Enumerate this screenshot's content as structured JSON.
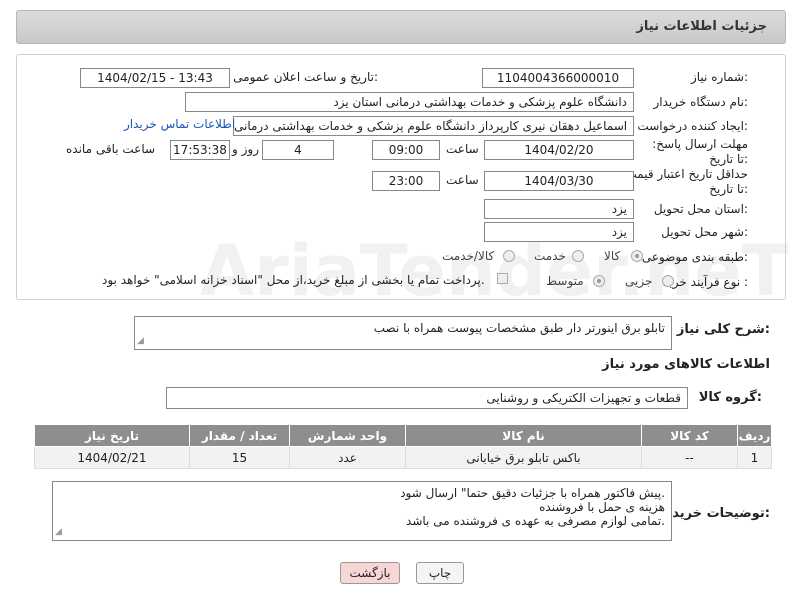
{
  "header": {
    "title": "جزئیات اطلاعات نیاز"
  },
  "watermark": "AriaTender.neT",
  "fields": {
    "need_number_label": "شماره نیاز:",
    "need_number": "1104004366000010",
    "announce_label": "تاریخ و ساعت اعلان عمومی:",
    "announce_value": "1404/02/15 - 13:43",
    "buyer_org_label": "نام دستگاه خریدار:",
    "buyer_org": "دانشگاه علوم پزشکی و خدمات بهداشتی  درمانی استان یزد",
    "creator_label": "ایجاد کننده درخواست:",
    "creator": "اسماعیل دهقان نیری کارپرداز دانشگاه علوم پزشکی و خدمات بهداشتی  درمانی",
    "contact_link": "اطلاعات تماس خریدار",
    "reply_deadline_label": "مهلت ارسال پاسخ: تا تاریخ:",
    "reply_date": "1404/02/20",
    "time_label": "ساعت",
    "reply_time": "09:00",
    "days_value": "4",
    "days_label": "روز و",
    "remaining_time": "17:53:38",
    "remaining_label": "ساعت باقی مانده",
    "price_deadline_label": "حداقل تاریخ اعتبار قیمت: تا تاریخ:",
    "price_date": "1404/03/30",
    "price_time": "23:00",
    "province_label": "استان محل تحویل:",
    "province": "یزد",
    "city_label": "شهر محل تحویل:",
    "city": "یزد",
    "category_label": "طبقه بندی موضوعی:",
    "category_options": [
      "کالا",
      "خدمت",
      "کالا/خدمت"
    ],
    "process_label": "نوع فرآیند خرید :",
    "process_options": [
      "جزیی",
      "متوسط"
    ],
    "payment_note": "پرداخت تمام یا بخشی از مبلغ خرید،از محل \"اسناد خزانه اسلامی\" خواهد بود."
  },
  "description": {
    "label": "شرح کلی نیاز:",
    "text": "تابلو برق اینورتر دار  طبق مشخصات پیوست همراه با نصب"
  },
  "goods": {
    "section_title": "اطلاعات کالاهای مورد نیاز",
    "group_label": "گروه کالا:",
    "group_value": "قطعات و تجهیزات الکتریکی و روشنایی",
    "columns": [
      "ردیف",
      "کد کالا",
      "نام کالا",
      "واحد شمارش",
      "تعداد / مقدار",
      "تاریخ نیاز"
    ],
    "rows": [
      [
        "1",
        "--",
        "باکس تابلو برق خیابانی",
        "عدد",
        "15",
        "1404/02/21"
      ]
    ]
  },
  "buyer_notes": {
    "label": "توضیحات خریدار:",
    "lines": [
      "پیش فاکتور  همراه با جزئیات  دقیق حتما\" ارسال شود.",
      "هزینه ی حمل با فروشنده",
      "تمامی لوازم مصرفی به عهده ی فروشنده می باشد."
    ]
  },
  "buttons": {
    "print": "چاپ",
    "back": "بازگشت"
  }
}
